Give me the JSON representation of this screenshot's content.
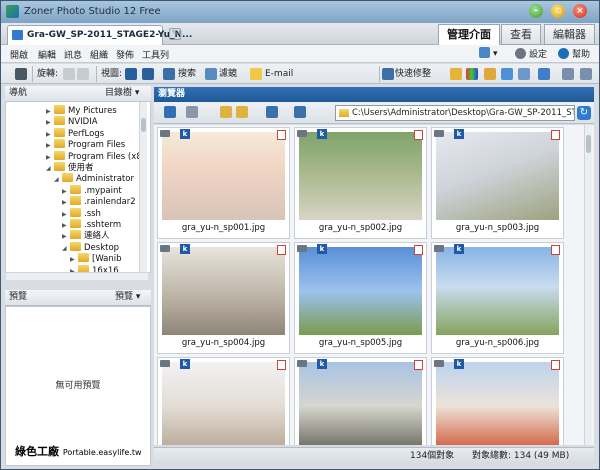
{
  "window": {
    "title": "Zoner Photo Studio 12 Free"
  },
  "document_tab": {
    "label": "Gra-GW_SP-2011_STAGE2-Yu_N..."
  },
  "modes": [
    "管理介面",
    "查看",
    "編輯器"
  ],
  "menu": {
    "items": [
      "開啟",
      "編輯",
      "訊息",
      "組織",
      "發佈",
      "工具列"
    ],
    "settings": "設定",
    "help": "幫助"
  },
  "toolbar": {
    "rotate": "旋轉:",
    "view": "視圖:",
    "search": "搜索",
    "filter": "濾鏡",
    "email": "E-mail",
    "quickfix": "快速修整"
  },
  "nav_panel": {
    "title": "導航",
    "mode": "目錄樹",
    "tree": [
      {
        "label": "My Pictures",
        "indent": 4
      },
      {
        "label": "NVIDIA",
        "indent": 4
      },
      {
        "label": "PerfLogs",
        "indent": 4
      },
      {
        "label": "Program Files",
        "indent": 4
      },
      {
        "label": "Program Files (x86",
        "indent": 4
      },
      {
        "label": "使用者",
        "indent": 4
      },
      {
        "label": "Administrator",
        "indent": 5
      },
      {
        "label": ".mypaint",
        "indent": 6
      },
      {
        "label": ".rainlendar2",
        "indent": 6
      },
      {
        "label": ".ssh",
        "indent": 6
      },
      {
        "label": ".sshterm",
        "indent": 6
      },
      {
        "label": "連絡人",
        "indent": 6
      },
      {
        "label": "Desktop",
        "indent": 6
      },
      {
        "label": "[Wanib",
        "indent": 7
      },
      {
        "label": "16x16",
        "indent": 7
      }
    ]
  },
  "preview_panel": {
    "title": "預覽",
    "mode": "預覽",
    "empty": "無可用預覽"
  },
  "browser": {
    "title": "瀏覽器",
    "path": "C:\\Users\\Administrator\\Desktop\\Gra-GW_SP-2011_STAGE"
  },
  "thumbnails": [
    {
      "caption": "gra_yu-n_sp001.jpg"
    },
    {
      "caption": "gra_yu-n_sp002.jpg"
    },
    {
      "caption": "gra_yu-n_sp003.jpg"
    },
    {
      "caption": "gra_yu-n_sp004.jpg"
    },
    {
      "caption": "gra_yu-n_sp005.jpg"
    },
    {
      "caption": "gra_yu-n_sp006.jpg"
    },
    {
      "caption": ""
    },
    {
      "caption": ""
    },
    {
      "caption": ""
    }
  ],
  "status": {
    "count": "134個對象",
    "total": "對象總數: 134 (49 MB)"
  },
  "watermark": {
    "main": "綠色工廠",
    "sub": "Portable.easylife.tw"
  }
}
